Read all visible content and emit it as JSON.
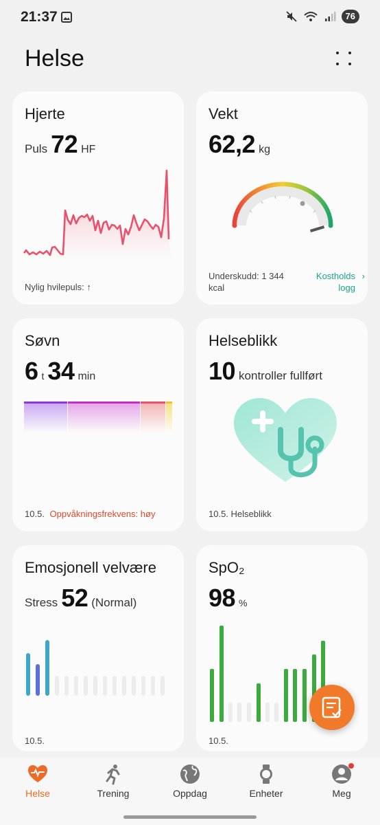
{
  "status_bar": {
    "time": "21:37",
    "battery": "76"
  },
  "app": {
    "title": "Helse"
  },
  "cards": {
    "heart": {
      "title": "Hjerte",
      "metric_label": "Puls",
      "value": "72",
      "unit": "HF",
      "footnote": "Nylig hvilepuls: ↑",
      "accent_color": "#e9506a"
    },
    "weight": {
      "title": "Vekt",
      "value": "62,2",
      "unit": "kg",
      "footnote": "Underskudd: 1 344 kcal",
      "link_label": "Kostholds logg",
      "link_color": "#1aa58a"
    },
    "sleep": {
      "title": "Søvn",
      "hours": "6",
      "hours_unit": "t",
      "minutes": "34",
      "minutes_unit": "min",
      "date": "10.5.",
      "warning": "Oppvåkningsfrekvens: høy",
      "warning_color": "#e0482a"
    },
    "health_check": {
      "title": "Helseblikk",
      "value": "10",
      "value_label": "kontroller fullført",
      "footnote": "10.5. Helseblikk"
    },
    "emotional": {
      "title": "Emosjonell velvære",
      "metric_label": "Stress",
      "value": "52",
      "status": "(Normal)",
      "date": "10.5."
    },
    "spo2": {
      "title": "SpO₂",
      "value": "98",
      "unit": "%",
      "date": "10.5."
    }
  },
  "nav": {
    "items": [
      {
        "label": "Helse",
        "icon": "heart-pulse-icon",
        "active": true
      },
      {
        "label": "Trening",
        "icon": "running-icon",
        "active": false
      },
      {
        "label": "Oppdag",
        "icon": "globe-icon",
        "active": false
      },
      {
        "label": "Enheter",
        "icon": "watch-icon",
        "active": false
      },
      {
        "label": "Meg",
        "icon": "profile-icon",
        "active": false,
        "badge": true
      }
    ]
  },
  "colors": {
    "accent": "#f07a2a",
    "background": "#f1f1f1",
    "card": "#fbfbfb"
  }
}
